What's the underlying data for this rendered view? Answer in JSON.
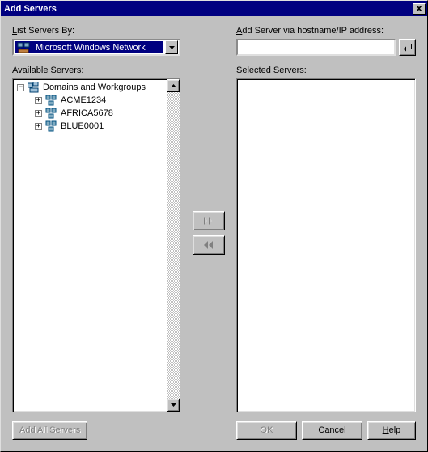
{
  "title": "Add Servers",
  "left": {
    "list_by_label_pre": "L",
    "list_by_label_rest": "ist Servers By:",
    "dropdown_value": "Microsoft Windows Network",
    "available_label_pre": "A",
    "available_label_rest": "vailable Servers:",
    "tree": {
      "root": "Domains and Workgroups",
      "children": [
        "ACME1234",
        "AFRICA5678",
        "BLUE0001"
      ]
    },
    "add_all": "Add All Servers"
  },
  "right": {
    "add_via_label_pre": "A",
    "add_via_label_rest": "dd Server via hostname/IP address:",
    "hostname_value": "",
    "selected_label_pre": "S",
    "selected_label_rest": "elected Servers:"
  },
  "buttons": {
    "ok": "OK",
    "cancel": "Cancel",
    "help_pre": "H",
    "help_rest": "elp"
  }
}
